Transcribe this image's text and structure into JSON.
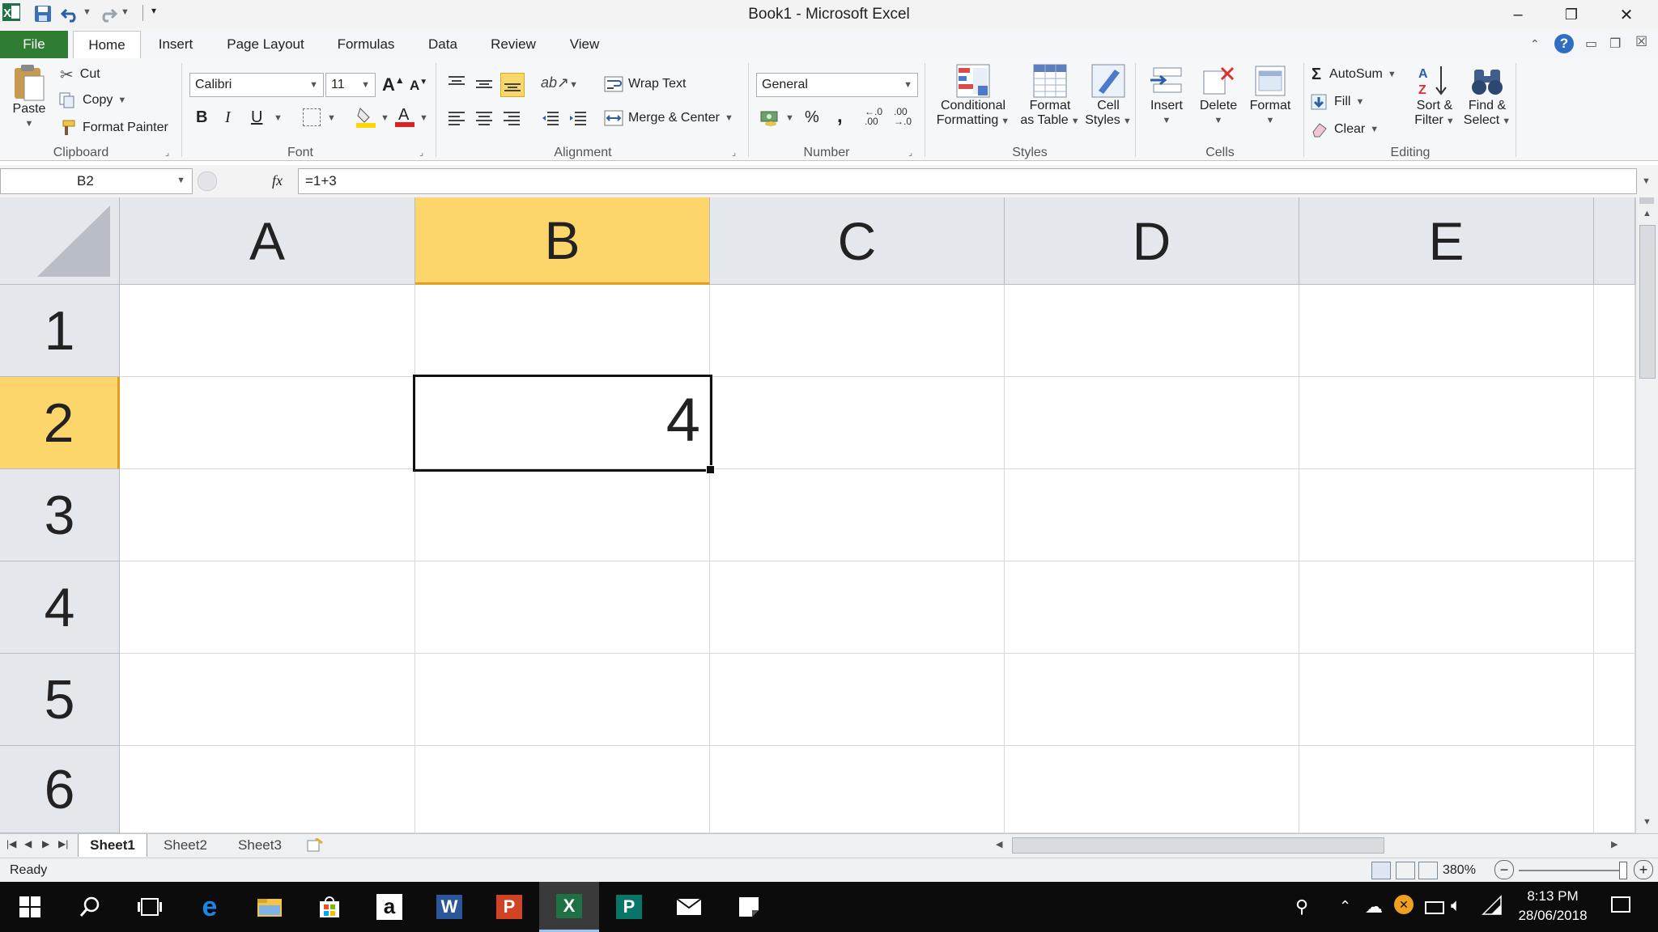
{
  "window": {
    "title": "Book1 - Microsoft Excel",
    "minimize": "–",
    "restore": "❐",
    "close": "✕"
  },
  "tabs": {
    "file": "File",
    "home": "Home",
    "insert": "Insert",
    "page_layout": "Page Layout",
    "formulas": "Formulas",
    "data": "Data",
    "review": "Review",
    "view": "View"
  },
  "clipboard": {
    "paste": "Paste",
    "cut": "Cut",
    "copy": "Copy",
    "format_painter": "Format Painter",
    "label": "Clipboard"
  },
  "font": {
    "name": "Calibri",
    "size": "11",
    "bold": "B",
    "italic": "I",
    "underline": "U",
    "label": "Font"
  },
  "alignment": {
    "wrap_text": "Wrap Text",
    "merge_center": "Merge & Center",
    "label": "Alignment"
  },
  "number": {
    "format": "General",
    "percent": "%",
    "comma": ",",
    "label": "Number"
  },
  "styles": {
    "conditional_1": "Conditional",
    "conditional_2": "Formatting",
    "table_1": "Format",
    "table_2": "as Table",
    "cell_1": "Cell",
    "cell_2": "Styles",
    "label": "Styles"
  },
  "cells": {
    "insert": "Insert",
    "delete": "Delete",
    "format": "Format",
    "label": "Cells"
  },
  "editing": {
    "autosum": "AutoSum",
    "fill": "Fill",
    "clear": "Clear",
    "sort_1": "Sort &",
    "sort_2": "Filter",
    "find_1": "Find &",
    "find_2": "Select",
    "label": "Editing"
  },
  "formula_bar": {
    "name_box": "B2",
    "fx": "fx",
    "formula": "=1+3"
  },
  "grid": {
    "columns": [
      "A",
      "B",
      "C",
      "D",
      "E"
    ],
    "rows": [
      "1",
      "2",
      "3",
      "4",
      "5",
      "6"
    ],
    "selected_column": "B",
    "selected_row": "2",
    "b2_value": "4"
  },
  "sheets": {
    "tab1": "Sheet1",
    "tab2": "Sheet2",
    "tab3": "Sheet3"
  },
  "status": {
    "mode": "Ready",
    "zoom": "380%"
  },
  "taskbar": {
    "time": "8:13 PM",
    "date": "28/06/2018"
  },
  "colors": {
    "file_tab": "#2e7d32",
    "selection_header": "#fcd66a",
    "selection_accent": "#e39d1f",
    "taskbar": "#0c0c0c"
  }
}
